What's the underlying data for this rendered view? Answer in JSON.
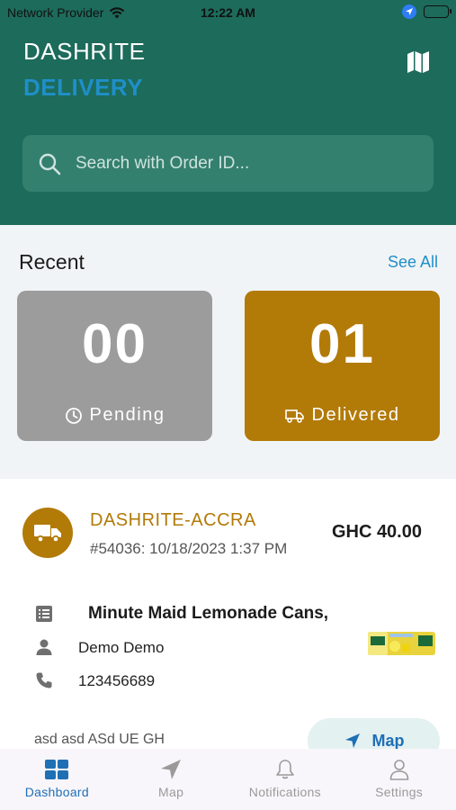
{
  "status_bar": {
    "carrier": "Network Provider",
    "time": "12:22 AM"
  },
  "brand": {
    "line1": "DASHRITE",
    "line2": "DELIVERY"
  },
  "search": {
    "placeholder": "Search with Order ID..."
  },
  "recent": {
    "title": "Recent",
    "see_all": "See All",
    "pending": {
      "count": "00",
      "label": "Pending",
      "color": "#9c9c9c"
    },
    "delivered": {
      "count": "01",
      "label": "Delivered",
      "color": "#b27a07"
    }
  },
  "order": {
    "store": "DASHRITE-ACCRA",
    "meta": "#54036: 10/18/2023 1:37 PM",
    "price": "GHC 40.00",
    "item": "Minute Maid Lemonade Cans,",
    "customer": "Demo Demo",
    "phone": "123456689",
    "address": "asd asd ASd UE GH",
    "map_button": "Map"
  },
  "tabs": [
    {
      "label": "Dashboard",
      "icon": "dashboard-icon",
      "active": true
    },
    {
      "label": "Map",
      "icon": "navigation-icon",
      "active": false
    },
    {
      "label": "Notifications",
      "icon": "bell-icon",
      "active": false
    },
    {
      "label": "Settings",
      "icon": "person-icon",
      "active": false
    }
  ],
  "colors": {
    "header": "#1d6b5b",
    "accent": "#1f8fc9",
    "gold": "#b27a07",
    "link": "#1f6fb5"
  }
}
